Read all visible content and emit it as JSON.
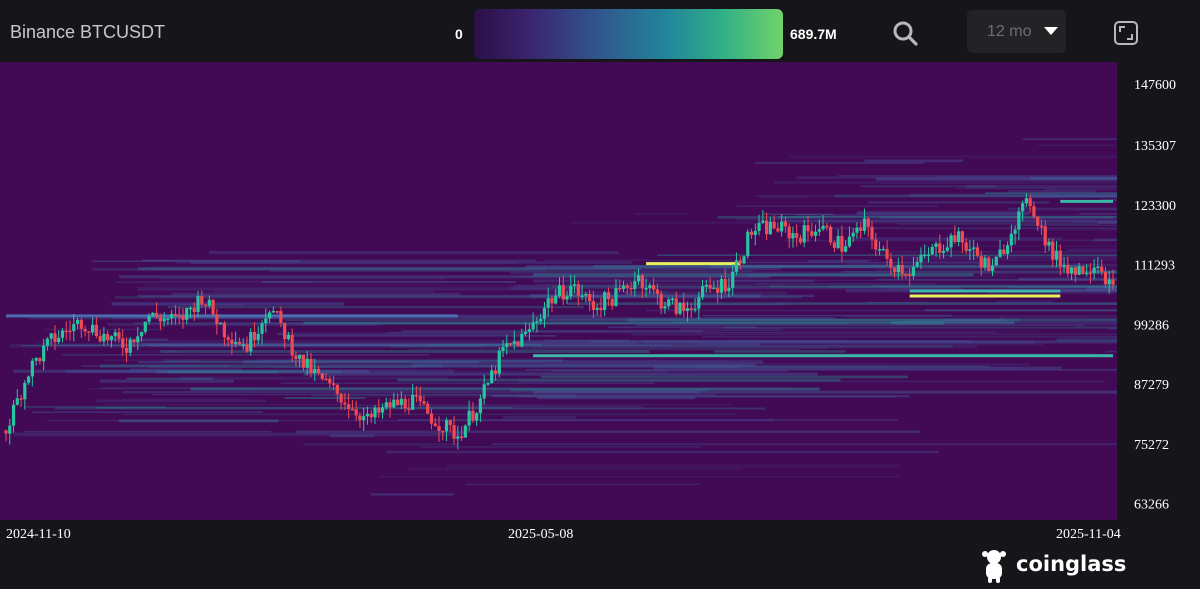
{
  "header": {
    "title": "Binance BTCUSDT",
    "scale_min": "0",
    "scale_max": "689.7M",
    "range": "12 mo"
  },
  "icons": {
    "search": "search-icon",
    "fullscreen": "fullscreen-icon",
    "dropdown": "chevron-down-icon",
    "brand": "coinglass-logo-icon"
  },
  "colors": {
    "background": "#16161a",
    "heatmap_base": "#420a55",
    "up": "#26c6a0",
    "down": "#ef4a54",
    "gradient": [
      "#2c0f46",
      "#3b2470",
      "#2f5a8f",
      "#22849a",
      "#2fae88",
      "#71d36a"
    ]
  },
  "brand": {
    "name": "coinglass"
  },
  "chart_data": {
    "type": "heatmap",
    "title": "Binance BTCUSDT",
    "x_ticks": [
      "2024-11-10",
      "2025-05-08",
      "2025-11-04"
    ],
    "y_ticks": [
      147600,
      135307,
      123300,
      111293,
      99286,
      87279,
      75272,
      63266
    ],
    "y_range": [
      60000,
      152000
    ],
    "color_scale": {
      "min": 0,
      "max": "689.7M"
    },
    "price_path": [
      [
        0,
        78000
      ],
      [
        6,
        90000
      ],
      [
        12,
        96000
      ],
      [
        20,
        100000
      ],
      [
        26,
        97000
      ],
      [
        32,
        95000
      ],
      [
        38,
        101000
      ],
      [
        46,
        100000
      ],
      [
        52,
        105000
      ],
      [
        58,
        98000
      ],
      [
        64,
        95000
      ],
      [
        70,
        103000
      ],
      [
        78,
        92000
      ],
      [
        84,
        88000
      ],
      [
        90,
        84000
      ],
      [
        96,
        80000
      ],
      [
        102,
        83000
      ],
      [
        108,
        84000
      ],
      [
        114,
        80000
      ],
      [
        120,
        77000
      ],
      [
        126,
        84000
      ],
      [
        132,
        94000
      ],
      [
        138,
        97000
      ],
      [
        144,
        104000
      ],
      [
        150,
        107000
      ],
      [
        156,
        103000
      ],
      [
        162,
        105000
      ],
      [
        168,
        109000
      ],
      [
        174,
        104000
      ],
      [
        180,
        102000
      ],
      [
        186,
        106000
      ],
      [
        192,
        108000
      ],
      [
        198,
        118000
      ],
      [
        204,
        119000
      ],
      [
        210,
        117000
      ],
      [
        216,
        119000
      ],
      [
        222,
        115000
      ],
      [
        228,
        119000
      ],
      [
        234,
        112000
      ],
      [
        240,
        110000
      ],
      [
        246,
        114000
      ],
      [
        252,
        117000
      ],
      [
        258,
        113000
      ],
      [
        262,
        110000
      ],
      [
        268,
        120000
      ],
      [
        272,
        124000
      ],
      [
        278,
        113000
      ],
      [
        284,
        110000
      ],
      [
        290,
        112000
      ],
      [
        294,
        106000
      ]
    ],
    "liquidity_bands": [
      {
        "price": 111500,
        "from": 170,
        "to": 195,
        "intensity": 1.0
      },
      {
        "price": 105000,
        "from": 240,
        "to": 280,
        "intensity": 0.95
      },
      {
        "price": 106000,
        "from": 240,
        "to": 280,
        "intensity": 0.6
      },
      {
        "price": 124000,
        "from": 280,
        "to": 294,
        "intensity": 0.6
      },
      {
        "price": 93000,
        "from": 140,
        "to": 294,
        "intensity": 0.55
      },
      {
        "price": 101000,
        "from": 0,
        "to": 120,
        "intensity": 0.45
      }
    ]
  }
}
